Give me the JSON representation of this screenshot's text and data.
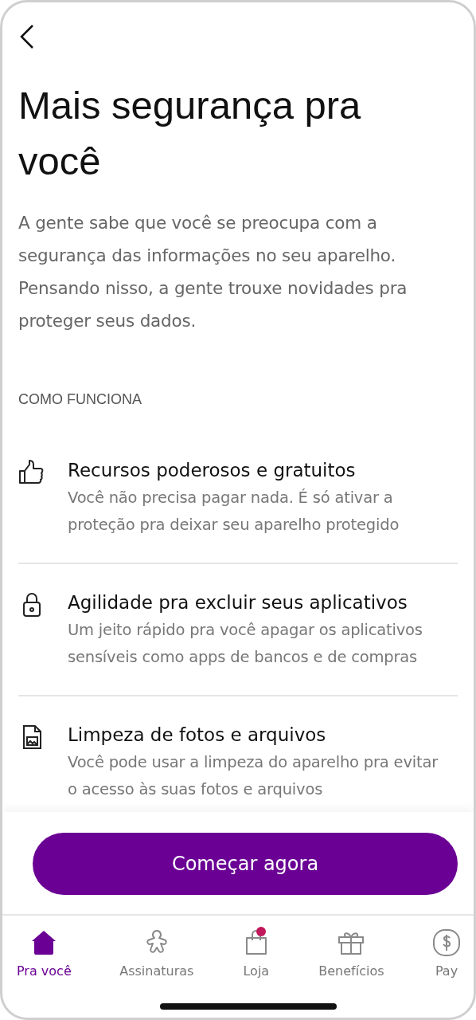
{
  "header": {
    "back": true
  },
  "title": "Mais segurança pra você",
  "intro": "A gente sabe que você se preocupa com a segurança das informações no seu aparelho. Pensando nisso, a gente trouxe novidades pra proteger seus dados.",
  "section_label": "COMO FUNCIONA",
  "features": [
    {
      "kind": "thumb",
      "title": "Recursos poderosos e gratuitos",
      "description": "Você não precisa pagar nada. É só ativar a proteção pra deixar seu aparelho protegido"
    },
    {
      "kind": "lock",
      "title": "Agilidade pra excluir seus aplicativos",
      "description": "Um jeito rápido pra você apagar os aplicativos sensíveis como apps de bancos e de compras"
    },
    {
      "kind": "file",
      "title": "Limpeza de fotos e arquivos",
      "description": "Você pode usar a limpeza do aparelho pra evitar o acesso às suas fotos e arquivos"
    }
  ],
  "primary_button": "Começar agora",
  "nav": [
    {
      "kind": "home",
      "label": "Pra você",
      "selected": true,
      "badge": false
    },
    {
      "kind": "figure",
      "label": "Assinaturas",
      "selected": false,
      "badge": false
    },
    {
      "kind": "bag",
      "label": "Loja",
      "selected": false,
      "badge": true
    },
    {
      "kind": "gift",
      "label": "Benefícios",
      "selected": false,
      "badge": false
    },
    {
      "kind": "dollar",
      "label": "Pay",
      "selected": false,
      "badge": false
    }
  ]
}
